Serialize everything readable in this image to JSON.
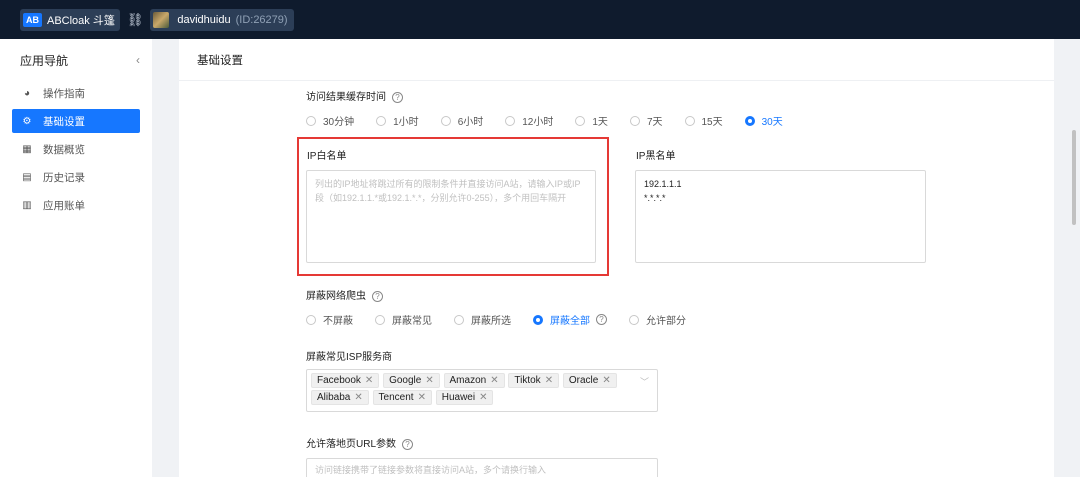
{
  "topbar": {
    "brand_logo": "AB",
    "brand_name": "ABCloak 斗篷",
    "link_icon": "link-icon",
    "username": "davidhuidu",
    "user_id": "(ID:26279)"
  },
  "sidebar": {
    "title": "应用导航",
    "collapse": "‹",
    "items": [
      {
        "label": "操作指南",
        "icon": "◕",
        "active": false
      },
      {
        "label": "基础设置",
        "icon": "⚙",
        "active": true
      },
      {
        "label": "数据概览",
        "icon": "▦",
        "active": false
      },
      {
        "label": "历史记录",
        "icon": "▤",
        "active": false
      },
      {
        "label": "应用账单",
        "icon": "▥",
        "active": false
      }
    ]
  },
  "main": {
    "title": "基础设置",
    "cache": {
      "label": "访问结果缓存时间",
      "options": [
        "30分钟",
        "1小时",
        "6小时",
        "12小时",
        "1天",
        "7天",
        "15天",
        "30天"
      ],
      "selected": "30天"
    },
    "whitelist": {
      "label": "IP白名单",
      "placeholder": "列出的IP地址将跳过所有的限制条件并直接访问A站，请输入IP或IP段（如192.1.1.*或192.1.*.*，分别允许0-255），多个用回车隔开"
    },
    "blacklist": {
      "label": "IP黑名单",
      "value_lines": [
        "192.1.1.1",
        "*.*.*.*"
      ]
    },
    "crawler": {
      "label": "屏蔽网络爬虫",
      "options": [
        "不屏蔽",
        "屏蔽常见",
        "屏蔽所选",
        "屏蔽全部",
        "允许部分"
      ],
      "selected": "屏蔽全部"
    },
    "isp": {
      "label": "屏蔽常见ISP服务商",
      "tags": [
        "Facebook",
        "Google",
        "Amazon",
        "Tiktok",
        "Oracle",
        "Alibaba",
        "Tencent",
        "Huawei"
      ]
    },
    "url_params": {
      "label": "允许落地页URL参数",
      "placeholder": "访问链接携带了链接参数将直接访问A站，多个请换行输入"
    }
  },
  "colors": {
    "accent": "#1677ff",
    "topbar": "#0f1b2d",
    "highlight": "#e53935"
  }
}
